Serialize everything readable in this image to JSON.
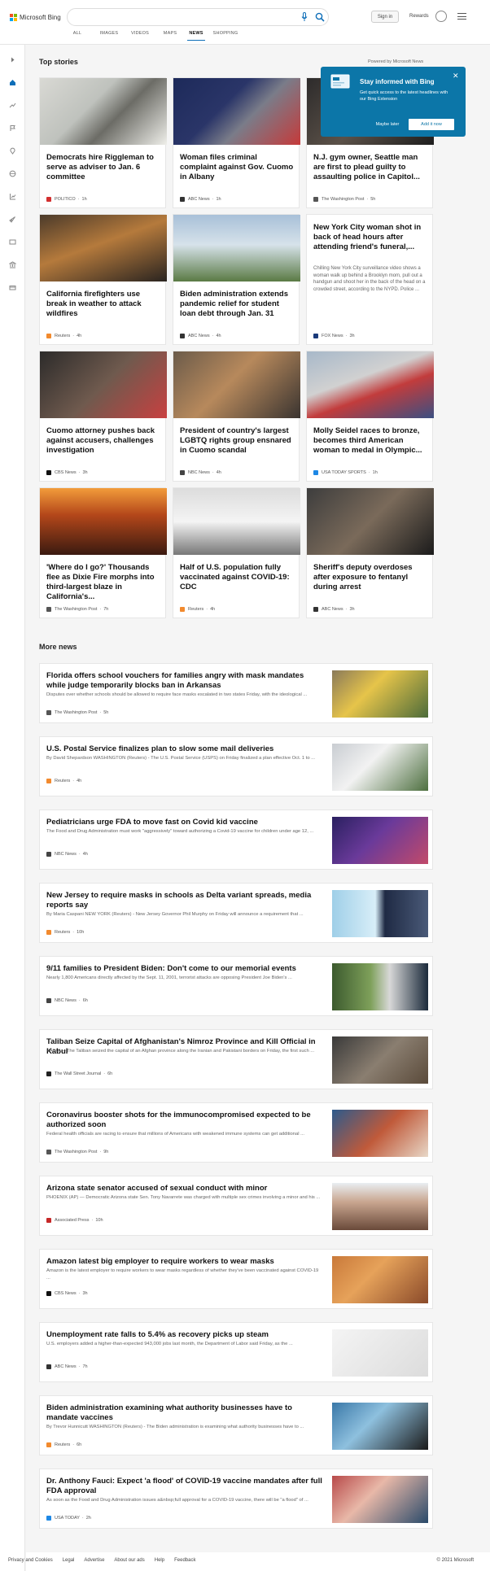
{
  "header": {
    "logo_text": "Microsoft Bing",
    "signin": "Sign in",
    "rewards": "Rewards"
  },
  "nav": [
    "ALL",
    "IMAGES",
    "VIDEOS",
    "MAPS",
    "NEWS",
    "SHOPPING"
  ],
  "top_stories": {
    "title": "Top stories",
    "powered": "Powered by Microsoft News"
  },
  "popup": {
    "title": "Stay informed with Bing",
    "body": "Get quick access to the latest headlines with our Bing Extension",
    "later": "Maybe later",
    "install": "Add it now"
  },
  "cards": [
    {
      "title": "Democrats hire Riggleman to serve as adviser to Jan. 6 committee",
      "snippet": "",
      "source": "POLITICO",
      "time": "1h",
      "logo": "#d32f2f"
    },
    {
      "title": "Woman files criminal complaint against Gov. Cuomo in Albany",
      "snippet": "",
      "source": "ABC News",
      "time": "1h",
      "logo": "#333333"
    },
    {
      "title": "N.J. gym owner, Seattle man are first to plead guilty to assaulting police in Capitol...",
      "snippet": "",
      "source": "The Washington Post",
      "time": "5h",
      "logo": "#555555"
    },
    {
      "title": "California firefighters use break in weather to attack wildfires",
      "snippet": "",
      "source": "Reuters",
      "time": "4h",
      "logo": "#f28a2e"
    },
    {
      "title": "Biden administration extends pandemic relief for student loan debt through Jan. 31",
      "snippet": "",
      "source": "ABC News",
      "time": "4h",
      "logo": "#333333"
    },
    {
      "title": "New York City woman shot in back of head hours after attending friend's funeral,...",
      "snippet": "Chilling New York City surveillance video shows a woman walk up behind a Brooklyn mom, pull out a handgun and shoot her in the back of the head on a crowded street, according to the NYPD. Police ...",
      "source": "FOX News",
      "time": "3h",
      "logo": "#1a3a7a"
    },
    {
      "title": "Cuomo attorney pushes back against accusers, challenges investigation",
      "snippet": "",
      "source": "CBS News",
      "time": "3h",
      "logo": "#111111"
    },
    {
      "title": "President of country's largest LGBTQ rights group ensnared in Cuomo scandal",
      "snippet": "",
      "source": "NBC News",
      "time": "4h",
      "logo": "#444444"
    },
    {
      "title": "Molly Seidel races to bronze, becomes third American woman to medal in Olympic...",
      "snippet": "",
      "source": "USA TODAY SPORTS",
      "time": "1h",
      "logo": "#1e88e5"
    },
    {
      "title": "'Where do I go?' Thousands flee as Dixie Fire morphs into third-largest blaze in California's...",
      "snippet": "",
      "source": "The Washington Post",
      "time": "7h",
      "logo": "#555555"
    },
    {
      "title": "Half of U.S. population fully vaccinated against COVID-19: CDC",
      "snippet": "",
      "source": "Reuters",
      "time": "4h",
      "logo": "#f28a2e"
    },
    {
      "title": "Sheriff's deputy overdoses after exposure to fentanyl during arrest",
      "snippet": "",
      "source": "ABC News",
      "time": "3h",
      "logo": "#333333"
    }
  ],
  "more_news": {
    "title": "More news"
  },
  "rows": [
    {
      "title": "Florida offers school vouchers for families angry with mask mandates while judge temporarily blocks ban in Arkansas",
      "snippet": "Disputes over whether schools should be allowed to require face masks escalated in two states Friday, with the ideological ...",
      "source": "The Washington Post",
      "time": "5h",
      "logo": "#555555"
    },
    {
      "title": "U.S. Postal Service finalizes plan to slow some mail deliveries",
      "snippet": "By David Shepardson WASHINGTON (Reuters) - The U.S. Postal Service (USPS) on Friday finalized a plan effective Oct. 1 to ...",
      "source": "Reuters",
      "time": "4h",
      "logo": "#f28a2e"
    },
    {
      "title": "Pediatricians urge FDA to move fast on Covid kid vaccine",
      "snippet": "The Food and Drug Administration must work \"aggressively\" toward authorizing a Covid-19 vaccine for children under age 12, ...",
      "source": "NBC News",
      "time": "4h",
      "logo": "#444444"
    },
    {
      "title": "New Jersey to require masks in schools as Delta variant spreads, media reports say",
      "snippet": "By Maria Caspani NEW YORK (Reuters) - New Jersey Governor Phil Murphy on Friday will announce a requirement that ...",
      "source": "Reuters",
      "time": "10h",
      "logo": "#f28a2e"
    },
    {
      "title": "9/11 families to President Biden: Don't come to our memorial events",
      "snippet": "Nearly 1,800 Americans directly affected by the Sept. 11, 2001, terrorist attacks are opposing President Joe Biden's ...",
      "source": "NBC News",
      "time": "6h",
      "logo": "#444444"
    },
    {
      "title": "Taliban Seize Capital of Afghanistan's Nimroz Province and Kill Official in Kabul",
      "snippet": "KABUL—The Taliban seized the capital of an Afghan province along the Iranian and Pakistani borders on Friday, the first such ...",
      "source": "The Wall Street Journal",
      "time": "6h",
      "logo": "#222222"
    },
    {
      "title": "Coronavirus booster shots for the immunocompromised expected to be authorized soon",
      "snippet": "Federal health officials are racing to ensure that millions of Americans with weakened immune systems can get additional ...",
      "source": "The Washington Post",
      "time": "9h",
      "logo": "#555555"
    },
    {
      "title": "Arizona state senator accused of sexual conduct with minor",
      "snippet": "PHOENIX (AP) — Democratic Arizona state Sen. Tony Navarrete was charged with multiple sex crimes involving a minor and his ...",
      "source": "Associated Press",
      "time": "10h",
      "logo": "#c62828"
    },
    {
      "title": "Amazon latest big employer to require workers to wear masks",
      "snippet": "Amazon is the latest employer to require workers to wear masks regardless of whether they've been vaccinated against COVID-19 ...",
      "source": "CBS News",
      "time": "3h",
      "logo": "#111111"
    },
    {
      "title": "Unemployment rate falls to 5.4% as recovery picks up steam",
      "snippet": "U.S. employers added a higher-than-expected 943,000 jobs last month, the Department of Labor said Friday, as the ...",
      "source": "ABC News",
      "time": "7h",
      "logo": "#333333"
    },
    {
      "title": "Biden administration examining what authority businesses have to mandate vaccines",
      "snippet": "By Trevor Hunnicutt WASHINGTON (Reuters) - The Biden administration is examining what authority businesses have to ...",
      "source": "Reuters",
      "time": "6h",
      "logo": "#f28a2e"
    },
    {
      "title": "Dr. Anthony Fauci: Expect 'a flood' of COVID-19 vaccine mandates after full FDA approval",
      "snippet": "As soon as the Food and Drug Administration issues a&nbsp;full approval for a COVID-19 vaccine, there will be \"a flood\" of ...",
      "source": "USA TODAY",
      "time": "2h",
      "logo": "#1e88e5"
    }
  ],
  "footer": {
    "links": [
      "Privacy and Cookies",
      "Legal",
      "Advertise",
      "About our ads",
      "Help",
      "Feedback"
    ],
    "copyright": "© 2021 Microsoft"
  }
}
